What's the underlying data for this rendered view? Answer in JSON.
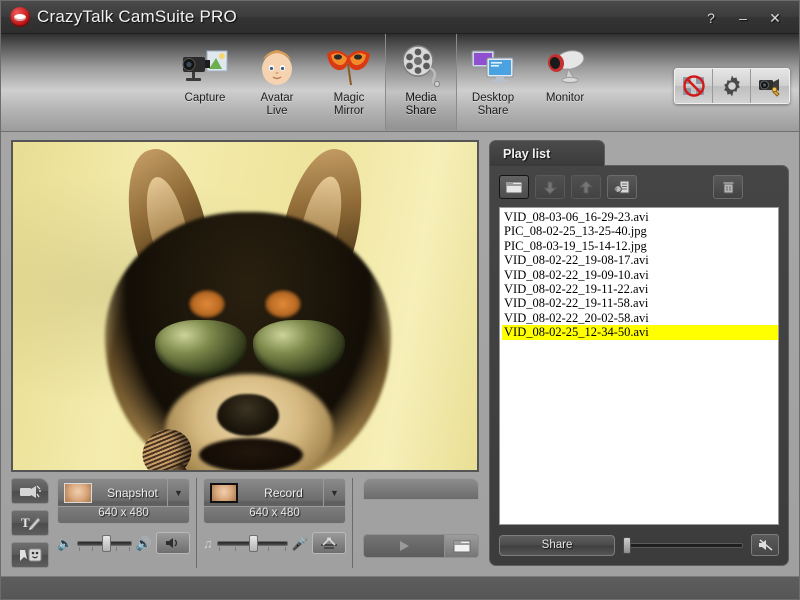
{
  "window": {
    "title": "CrazyTalk CamSuite PRO",
    "logo_icon": "crazytalk-lips-logo",
    "buttons": [
      {
        "name": "help-button",
        "label": "?"
      },
      {
        "name": "minimize-button",
        "label": "–"
      },
      {
        "name": "close-button",
        "label": "✕"
      }
    ]
  },
  "toolbar": {
    "items": [
      {
        "id": "capture",
        "label": "Capture",
        "icon": "camcorder-photo-icon",
        "selected": false
      },
      {
        "id": "avatar-live",
        "label": "Avatar\nLive",
        "icon": "baby-face-icon",
        "selected": false
      },
      {
        "id": "magic-mirror",
        "label": "Magic\nMirror",
        "icon": "carnival-mask-icon",
        "selected": false
      },
      {
        "id": "media-share",
        "label": "Media\nShare",
        "icon": "film-reel-icon",
        "selected": true
      },
      {
        "id": "desktop-share",
        "label": "Desktop\nShare",
        "icon": "two-monitors-icon",
        "selected": false
      },
      {
        "id": "monitor",
        "label": "Monitor",
        "icon": "webcam-icon",
        "selected": false
      }
    ],
    "corner_buttons": [
      {
        "id": "disable-webcam",
        "icon": "webcam-disabled-icon"
      },
      {
        "id": "settings",
        "icon": "gear-icon"
      },
      {
        "id": "camera-setup",
        "icon": "camera-wrench-icon"
      }
    ]
  },
  "preview": {
    "name": "video-preview",
    "description": "Shiba Inu dog wearing dark sunglasses singing into a microphone on a yellow background"
  },
  "side_tools": [
    {
      "id": "video-effect",
      "icon": "camera-effect-icon"
    },
    {
      "id": "text-tool",
      "icon": "text-pen-icon"
    },
    {
      "id": "emoticon",
      "icon": "emoticon-icon"
    }
  ],
  "snapshot": {
    "label": "Snapshot",
    "resolution": "640 x 480",
    "thumb_icon": "face-photo-icon",
    "dropdown_icon": "chevron-down-icon"
  },
  "record": {
    "label": "Record",
    "resolution": "640 x 480",
    "thumb_icon": "face-film-icon",
    "dropdown_icon": "chevron-down-icon"
  },
  "speaker": {
    "left_icon": "speaker-low-icon",
    "right_icon": "speaker-high-icon",
    "toggle_icon": "speaker-on-icon",
    "value": 50
  },
  "microphone": {
    "left_icon": "music-note-icon",
    "right_icon": "microphone-icon",
    "toggle_icon": "audio-mixer-icon",
    "value": 50
  },
  "transport": {
    "play_icon": "play-icon",
    "folder_icon": "folder-icon"
  },
  "playlist": {
    "tab_label": "Play list",
    "toolbar": [
      {
        "id": "add-file",
        "icon": "folder-open-icon",
        "state": "active"
      },
      {
        "id": "move-down",
        "icon": "arrow-down-icon",
        "state": "disabled"
      },
      {
        "id": "move-up",
        "icon": "arrow-up-icon",
        "state": "disabled"
      },
      {
        "id": "properties",
        "icon": "file-properties-icon",
        "state": "normal"
      },
      {
        "id": "delete",
        "icon": "trash-icon",
        "state": "normal"
      }
    ],
    "items": [
      {
        "name": "VID_08-03-06_16-29-23.avi",
        "selected": false
      },
      {
        "name": "PIC_08-02-25_13-25-40.jpg",
        "selected": false
      },
      {
        "name": "PIC_08-03-19_15-14-12.jpg",
        "selected": false
      },
      {
        "name": "VID_08-02-22_19-08-17.avi",
        "selected": false
      },
      {
        "name": "VID_08-02-22_19-09-10.avi",
        "selected": false
      },
      {
        "name": "VID_08-02-22_19-11-22.avi",
        "selected": false
      },
      {
        "name": "VID_08-02-22_19-11-58.avi",
        "selected": false
      },
      {
        "name": "VID_08-02-22_20-02-58.avi",
        "selected": false
      },
      {
        "name": "VID_08-02-25_12-34-50.avi",
        "selected": true
      }
    ],
    "share_button": "Share",
    "volume_value": 2,
    "mute_icon": "speaker-muted-icon",
    "selection_color": "#ffff00"
  },
  "colors": {
    "titlebar": "#3a3a3a",
    "window_bg": "#a0a0a0",
    "panel_bg": "#404040",
    "list_bg": "#ffffff",
    "highlight": "#ffff00",
    "logo_red": "#c01414"
  }
}
